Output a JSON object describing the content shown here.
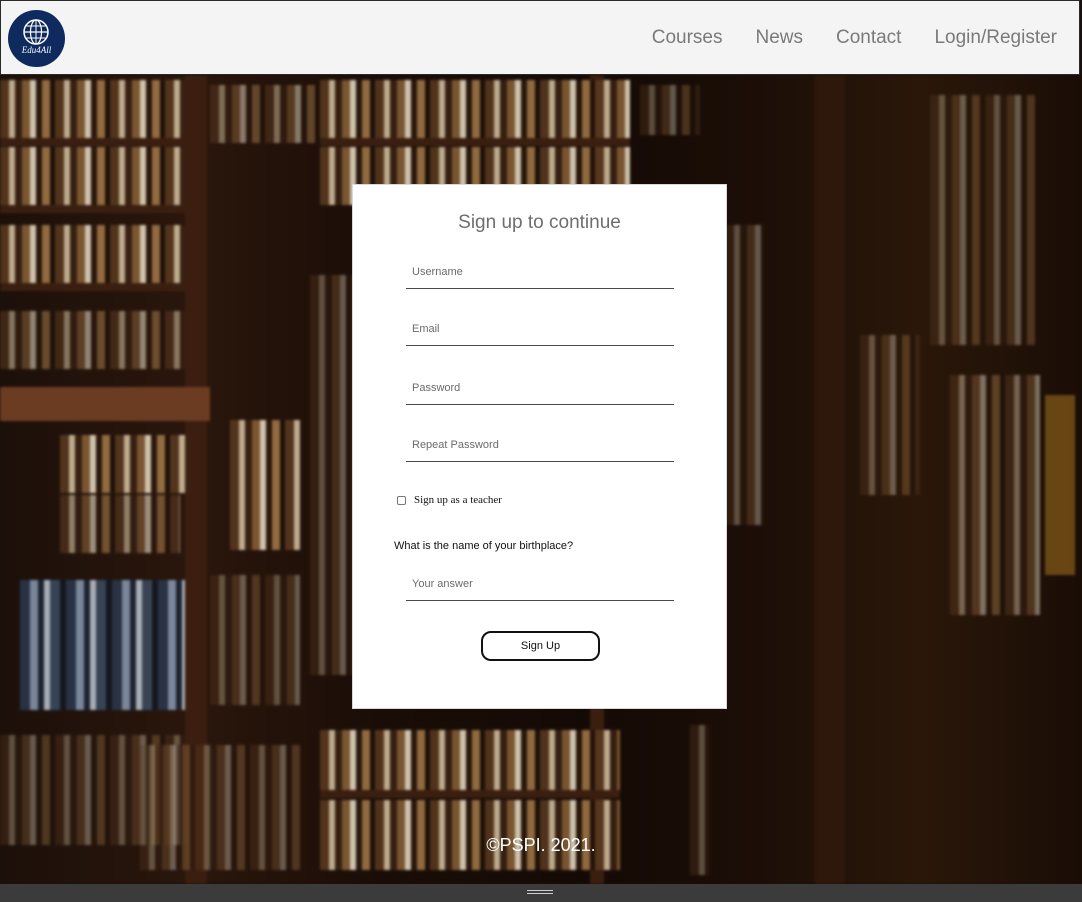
{
  "header": {
    "logo_text": "Edu4All",
    "nav": [
      "Courses",
      "News",
      "Contact",
      "Login/Register"
    ]
  },
  "form": {
    "title": "Sign up to continue",
    "username_placeholder": "Username",
    "email_placeholder": "Email",
    "password_placeholder": "Password",
    "repeat_password_placeholder": "Repeat Password",
    "teacher_checkbox_label": "Sign up as a teacher",
    "teacher_checkbox_checked": false,
    "security_question": "What is the name of your birthplace?",
    "answer_placeholder": "Your answer",
    "submit_label": "Sign Up"
  },
  "footer": {
    "copyright": "©PSPI. 2021."
  },
  "colors": {
    "header_bg": "#f4f4f4",
    "logo_bg": "#0e2a5e",
    "nav_text": "#7a7a7a",
    "card_bg": "#ffffff"
  },
  "icons": {
    "logo": "globe-icon",
    "resize": "drag-handle-icon"
  }
}
